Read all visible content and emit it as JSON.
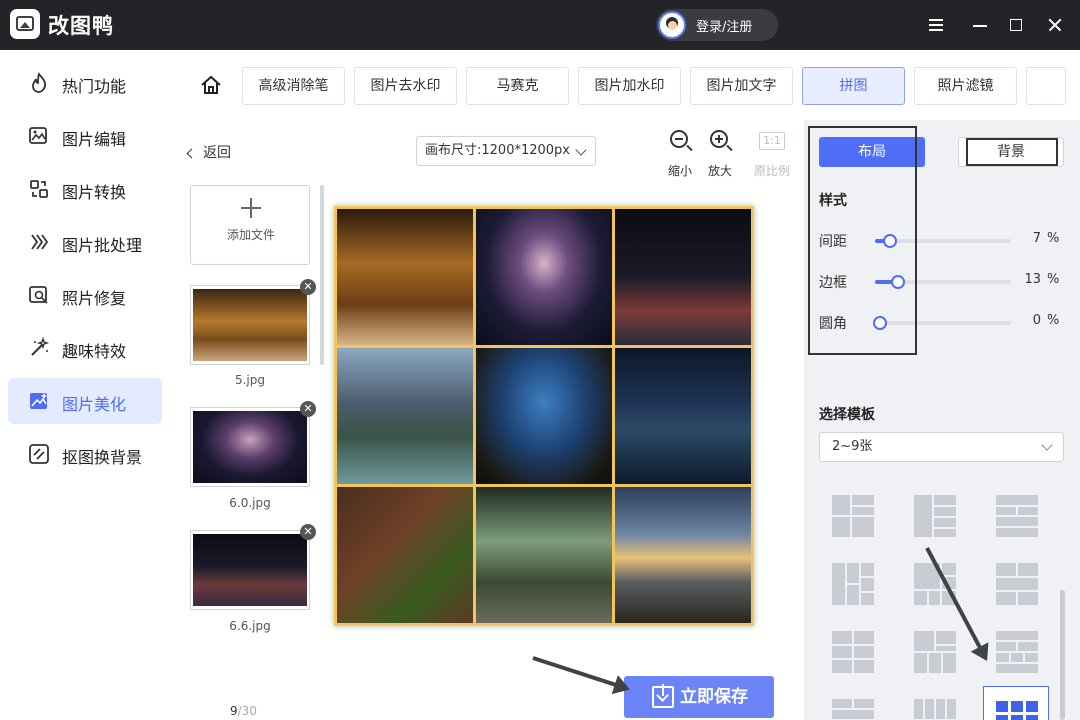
{
  "app": {
    "title": "改图鸭",
    "login_label": "登录/注册"
  },
  "sidebar": {
    "items": [
      {
        "label": "热门功能"
      },
      {
        "label": "图片编辑"
      },
      {
        "label": "图片转换"
      },
      {
        "label": "图片批处理"
      },
      {
        "label": "照片修复"
      },
      {
        "label": "趣味特效"
      },
      {
        "label": "图片美化"
      },
      {
        "label": "抠图换背景"
      }
    ],
    "active_index": 6
  },
  "tabs": [
    {
      "label": "高级消除笔"
    },
    {
      "label": "图片去水印"
    },
    {
      "label": "马赛克"
    },
    {
      "label": "图片加水印"
    },
    {
      "label": "图片加文字"
    },
    {
      "label": "拼图"
    },
    {
      "label": "照片滤镜"
    }
  ],
  "active_tab": "拼图",
  "canvas": {
    "back_label": "返回",
    "size_label": "画布尺寸:1200*1200px",
    "zoom_out_label": "缩小",
    "zoom_in_label": "放大",
    "ratio_icon_text": "1:1",
    "ratio_label": "原比例"
  },
  "files": {
    "add_label": "添加文件",
    "items": [
      {
        "name": "5.jpg"
      },
      {
        "name": "6.0.jpg"
      },
      {
        "name": "6.6.jpg"
      }
    ],
    "count_current": "9",
    "count_total": "/30"
  },
  "save_label": "立即保存",
  "panel": {
    "layout_label": "布局",
    "background_label": "背景",
    "style_title": "样式",
    "sliders": [
      {
        "label": "间距",
        "value": "7",
        "unit": "%",
        "level": 0.07
      },
      {
        "label": "边框",
        "value": "13",
        "unit": "%",
        "level": 0.13
      },
      {
        "label": "圆角",
        "value": "0",
        "unit": "%",
        "level": 0
      }
    ],
    "template_title": "选择模板",
    "template_select": "2~9张"
  },
  "colors": {
    "accent": "#4f6ef7",
    "titlebar": "#222428",
    "collage_border": "#f2c55a"
  }
}
